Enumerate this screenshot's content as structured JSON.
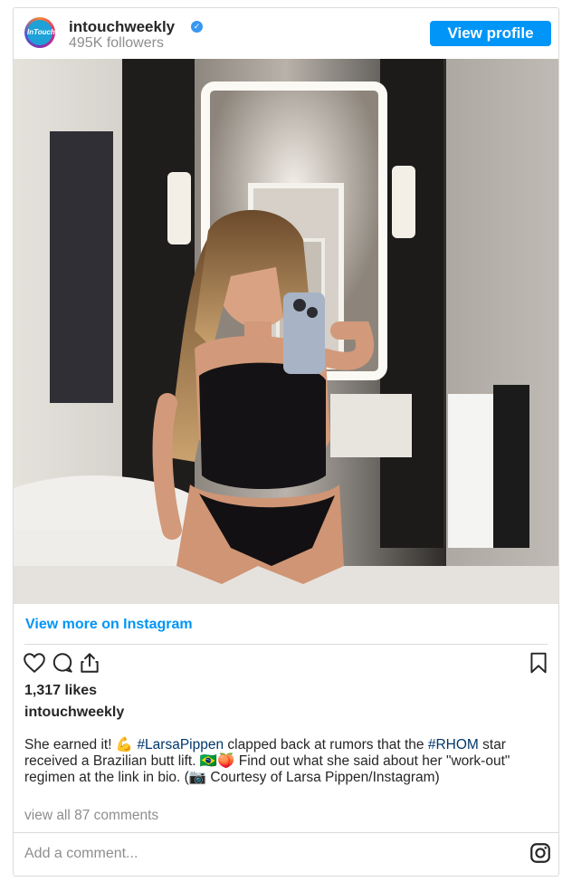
{
  "header": {
    "avatar_text": "InTouch",
    "username": "intouchweekly",
    "followers": "495K followers",
    "view_profile_label": "View profile"
  },
  "post": {
    "image_icon": "photo",
    "view_more_label": "View more on Instagram",
    "likes": "1,317 likes",
    "owner": "intouchweekly",
    "caption": {
      "part1": "She earned it! 💪 ",
      "tag1": "#LarsaPippen",
      "part2": " clapped back at rumors that the ",
      "tag2": "#RHOM",
      "part3": " star received a Brazilian butt lift. 🇧🇷🍑 Find out what she said about her \"work-out\" regimen at the link in bio. (📷 Courtesy of Larsa Pippen/Instagram)"
    },
    "comments_link": "view all 87 comments",
    "add_comment_placeholder": "Add a comment..."
  },
  "colors": {
    "accent": "#0095f6",
    "hashtag": "#00376b",
    "muted": "#8e8e8e",
    "border": "#dbdbdb"
  },
  "icons": [
    "verified-icon",
    "heart-icon",
    "comment-icon",
    "share-icon",
    "bookmark-icon",
    "instagram-icon"
  ]
}
